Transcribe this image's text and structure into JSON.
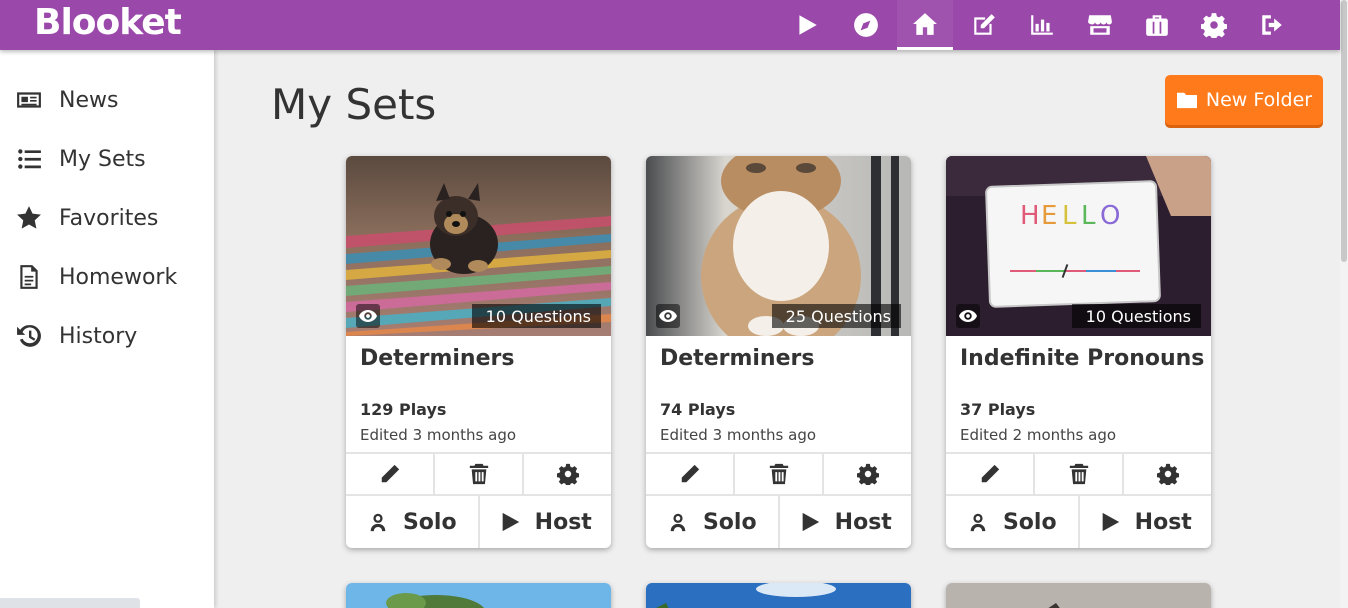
{
  "app": {
    "logo": "Blooket"
  },
  "nav": {
    "icons": [
      "play-icon",
      "compass-icon",
      "home-icon",
      "edit-icon",
      "stats-icon",
      "market-icon",
      "briefcase-icon",
      "gear-icon",
      "logout-icon"
    ],
    "active": "home-icon"
  },
  "sidebar": {
    "items": [
      {
        "label": "News",
        "icon": "newspaper-icon"
      },
      {
        "label": "My Sets",
        "icon": "list-icon"
      },
      {
        "label": "Favorites",
        "icon": "star-icon"
      },
      {
        "label": "Homework",
        "icon": "file-icon"
      },
      {
        "label": "History",
        "icon": "history-icon"
      }
    ]
  },
  "page": {
    "title": "My Sets",
    "new_folder_label": "New Folder"
  },
  "sets": [
    {
      "title": "Determiners",
      "questions": "10 Questions",
      "plays": "129 Plays",
      "edited": "Edited 3 months ago",
      "image": "puppy-on-rug"
    },
    {
      "title": "Determiners",
      "questions": "25 Questions",
      "plays": "74 Plays",
      "edited": "Edited 3 months ago",
      "image": "cat-sitting"
    },
    {
      "title": "Indefinite Pronouns",
      "questions": "10 Questions",
      "plays": "37 Plays",
      "edited": "Edited 2 months ago",
      "image": "hello-sign"
    }
  ],
  "buttons": {
    "solo": "Solo",
    "host": "Host"
  },
  "colors": {
    "header": "#9a49aa",
    "accent": "#ff7a1a"
  }
}
